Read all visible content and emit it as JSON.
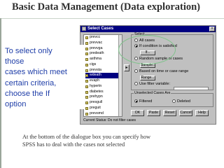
{
  "slide": {
    "title": "Basic Data Management (Data exploration)",
    "callout_lines": [
      "To select only",
      "those",
      "cases which meet",
      "certain criteria,",
      "choose the If",
      "option"
    ],
    "caption_lines": [
      "At the bottom of the dialogue box you can specify how",
      "SPSS has to deal with the cases not selected"
    ]
  },
  "dialog": {
    "title": "Select Cases",
    "variables": [
      "prevcc",
      "prevvac",
      "prevvga",
      "predeath",
      "asthma",
      "cigs",
      "prevsta",
      "wdeath",
      "evaph",
      "hypertn",
      "diabetes",
      "prehypn",
      "presgull",
      "preguit",
      "prevsmd",
      "dm",
      "hbefw"
    ],
    "selected_variable_index": 7,
    "arrow_label": "▸",
    "select_group_label": "Select",
    "opt_all_cases": "All cases",
    "opt_if": "If condition is satisfied",
    "if_button": "If...",
    "opt_random": "Random sample of cases",
    "sample_button": "Sample...",
    "opt_time": "Based on time or case range",
    "range_button": "Range...",
    "opt_filter": "Use filter variable:",
    "unselected_group_label": "Unselected Cases Are",
    "opt_filtered": "Filtered",
    "opt_deleted": "Deleted",
    "status_text": "Current Status: Do not filter cases",
    "buttons": [
      "OK",
      "Paste",
      "Reset",
      "Cancel",
      "Help"
    ]
  }
}
